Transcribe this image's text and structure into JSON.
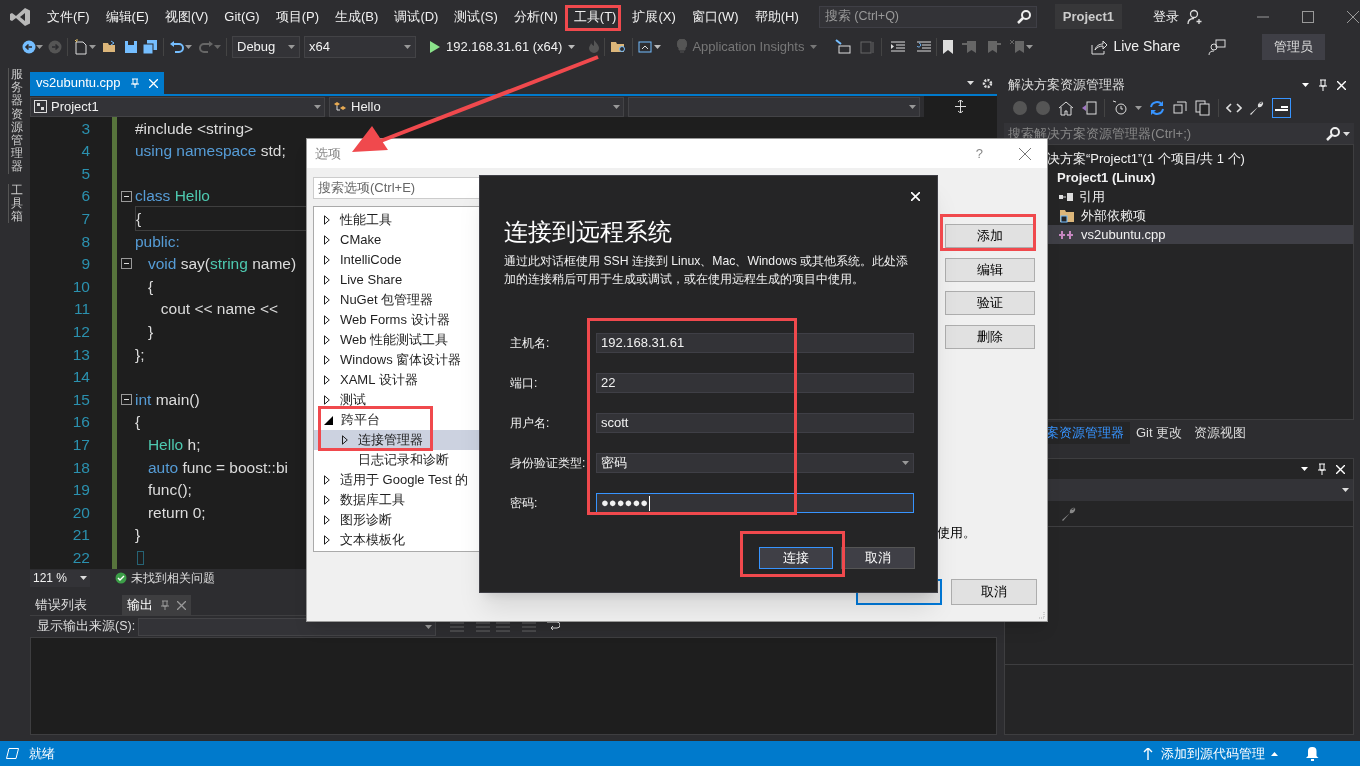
{
  "menu": [
    {
      "label": "文件(F)"
    },
    {
      "label": "编辑(E)"
    },
    {
      "label": "视图(V)"
    },
    {
      "label": "Git(G)"
    },
    {
      "label": "项目(P)"
    },
    {
      "label": "生成(B)"
    },
    {
      "label": "调试(D)"
    },
    {
      "label": "测试(S)"
    },
    {
      "label": "分析(N)"
    },
    {
      "label": "工具(T)"
    },
    {
      "label": "扩展(X)"
    },
    {
      "label": "窗口(W)"
    },
    {
      "label": "帮助(H)"
    }
  ],
  "search": {
    "placeholder": "搜索 (Ctrl+Q)"
  },
  "solution_name": "Project1",
  "sign_in": "登录",
  "toolbar": {
    "configuration": "Debug",
    "platform": "x64",
    "run_target": "192.168.31.61 (x64)",
    "insights": "Application Insights",
    "live_share": "Live Share",
    "admin": "管理员"
  },
  "side_tabs": [
    {
      "label": "服务器资源管理器"
    },
    {
      "label": "工具箱"
    }
  ],
  "editor": {
    "tabs": [
      {
        "label": "vs2ubuntu.cpp",
        "selected": true
      }
    ],
    "nav": [
      "Project1",
      "Hello"
    ],
    "lines": [
      {
        "number": "3",
        "fold": false,
        "highlight": false,
        "tokens": [
          {
            "text": "#include <string>",
            "kind": "plain"
          }
        ]
      },
      {
        "number": "4",
        "fold": false,
        "highlight": false,
        "tokens": [
          {
            "text": "using namespace",
            "kind": "kw"
          },
          {
            "text": " std;",
            "kind": "plain"
          }
        ]
      },
      {
        "number": "5",
        "fold": false,
        "highlight": false
      },
      {
        "number": "6",
        "fold": true,
        "highlight": false,
        "tokens": [
          {
            "text": "class",
            "kind": "kw"
          },
          {
            "text": " Hello",
            "kind": "type"
          }
        ]
      },
      {
        "number": "7",
        "fold": false,
        "highlight": true,
        "tokens": [
          {
            "text": "{",
            "kind": "plain"
          }
        ]
      },
      {
        "number": "8",
        "fold": false,
        "highlight": false,
        "tokens": [
          {
            "text": "public:",
            "kind": "kw"
          }
        ]
      },
      {
        "number": "9",
        "fold": true,
        "highlight": false,
        "tokens": [
          {
            "text": "   void",
            "kind": "kw"
          },
          {
            "text": " say(",
            "kind": "plain"
          },
          {
            "text": "string",
            "kind": "type"
          },
          {
            "text": " name)",
            "kind": "plain"
          }
        ]
      },
      {
        "number": "10",
        "fold": false,
        "highlight": false,
        "tokens": [
          {
            "text": "   {",
            "kind": "plain"
          }
        ]
      },
      {
        "number": "11",
        "fold": false,
        "highlight": false,
        "tokens": [
          {
            "text": "      cout << name <<",
            "kind": "plain"
          }
        ]
      },
      {
        "number": "12",
        "fold": false,
        "highlight": false,
        "tokens": [
          {
            "text": "   }",
            "kind": "plain"
          }
        ]
      },
      {
        "number": "13",
        "fold": false,
        "highlight": false,
        "tokens": [
          {
            "text": "};",
            "kind": "plain"
          }
        ]
      },
      {
        "number": "14",
        "fold": false,
        "highlight": false
      },
      {
        "number": "15",
        "fold": true,
        "highlight": false,
        "tokens": [
          {
            "text": "int",
            "kind": "kw"
          },
          {
            "text": " main()",
            "kind": "plain"
          }
        ]
      },
      {
        "number": "16",
        "fold": false,
        "highlight": false,
        "tokens": [
          {
            "text": "{",
            "kind": "plain"
          }
        ]
      },
      {
        "number": "17",
        "fold": false,
        "highlight": false,
        "tokens": [
          {
            "text": "   Hello",
            "kind": "type"
          },
          {
            "text": " h;",
            "kind": "plain"
          }
        ]
      },
      {
        "number": "18",
        "fold": false,
        "highlight": false,
        "tokens": [
          {
            "text": "   auto",
            "kind": "kw"
          },
          {
            "text": " func = boost::bi",
            "kind": "plain"
          }
        ]
      },
      {
        "number": "19",
        "fold": false,
        "highlight": false,
        "tokens": [
          {
            "text": "   func();",
            "kind": "plain"
          }
        ]
      },
      {
        "number": "20",
        "fold": false,
        "highlight": false,
        "tokens": [
          {
            "text": "   return 0;",
            "kind": "plain"
          }
        ]
      },
      {
        "number": "21",
        "fold": false,
        "highlight": false,
        "tokens": [
          {
            "text": "}",
            "kind": "plain"
          }
        ]
      },
      {
        "number": "22",
        "fold": false,
        "highlight": false
      }
    ],
    "zoom": "121 %",
    "issues": "未找到相关问题"
  },
  "output_panel": {
    "tabs": [
      {
        "label": "错误列表",
        "selected": false
      },
      {
        "label": "输出",
        "selected": true
      }
    ],
    "source_label": "显示输出来源(S):"
  },
  "solution_explorer": {
    "title": "解决方案资源管理器",
    "search_placeholder": "搜索解决方案资源管理器(Ctrl+;)",
    "tree": [
      {
        "label": "决方案“Project1”(1 个项目/共 1 个)",
        "selected": false,
        "children": [
          {
            "label": "Project1 (Linux)",
            "kind": "project",
            "selected": false,
            "children": [
              {
                "label": "引用",
                "kind": "references",
                "selected": false
              },
              {
                "label": "外部依赖项",
                "kind": "external",
                "selected": false
              },
              {
                "label": "vs2ubuntu.cpp",
                "kind": "cpp",
                "selected": true
              }
            ]
          }
        ]
      }
    ],
    "tabs": [
      {
        "label": "案资源管理器",
        "selected": true
      },
      {
        "label": "Git 更改",
        "selected": false
      },
      {
        "label": "资源视图",
        "selected": false
      }
    ]
  },
  "options_dialog": {
    "title": "选项",
    "help": "?",
    "search_placeholder": "搜索选项(Ctrl+E)",
    "tree": [
      {
        "label": "性能工具",
        "expandable": true,
        "expanded": false,
        "selected": false
      },
      {
        "label": "CMake",
        "expandable": true,
        "expanded": false,
        "selected": false
      },
      {
        "label": "IntelliCode",
        "expandable": true,
        "expanded": false,
        "selected": false
      },
      {
        "label": "Live Share",
        "expandable": true,
        "expanded": false,
        "selected": false
      },
      {
        "label": "NuGet 包管理器",
        "expandable": true,
        "expanded": false,
        "selected": false
      },
      {
        "label": "Web Forms 设计器",
        "expandable": true,
        "expanded": false,
        "selected": false
      },
      {
        "label": "Web 性能测试工具",
        "expandable": true,
        "expanded": false,
        "selected": false
      },
      {
        "label": "Windows 窗体设计器",
        "expandable": true,
        "expanded": false,
        "selected": false
      },
      {
        "label": "XAML 设计器",
        "expandable": true,
        "expanded": false,
        "selected": false
      },
      {
        "label": "测试",
        "expandable": true,
        "expanded": false,
        "selected": false
      },
      {
        "label": "跨平台",
        "expandable": true,
        "expanded": true,
        "selected": false,
        "children": [
          {
            "label": "连接管理器",
            "expandable": true,
            "expanded": false,
            "selected": true
          },
          {
            "label": "日志记录和诊断",
            "expandable": false,
            "selected": false
          }
        ]
      },
      {
        "label": "适用于 Google Test 的",
        "expandable": true,
        "expanded": false,
        "selected": false
      },
      {
        "label": "数据库工具",
        "expandable": true,
        "expanded": false,
        "selected": false
      },
      {
        "label": "图形诊断",
        "expandable": true,
        "expanded": false,
        "selected": false
      },
      {
        "label": "文本模板化",
        "expandable": true,
        "expanded": false,
        "selected": false
      }
    ],
    "buttons": [
      "添加",
      "编辑",
      "验证",
      "删除"
    ],
    "note": "使用。",
    "cancel": "取消"
  },
  "connect_dialog": {
    "heading": "连接到远程系统",
    "description": "通过此对话框使用 SSH 连接到 Linux、Mac、Windows 或其他系统。此处添加的连接稍后可用于生成或调试，或在使用远程生成的项目中使用。",
    "fields": [
      {
        "label": "主机名:",
        "value": "192.168.31.61",
        "kind": "text",
        "focused": false
      },
      {
        "label": "端口:",
        "value": "22",
        "kind": "text",
        "focused": false
      },
      {
        "label": "用户名:",
        "value": "scott",
        "kind": "text",
        "focused": false
      },
      {
        "label": "身份验证类型:",
        "value": "密码",
        "kind": "select",
        "focused": false
      },
      {
        "label": "密码:",
        "value": "●●●●●●",
        "kind": "password",
        "focused": true
      }
    ],
    "buttons": [
      {
        "label": "连接",
        "default": true
      },
      {
        "label": "取消",
        "default": false
      }
    ]
  },
  "status_bar": {
    "text": "就绪",
    "source_control": "添加到源代码管理"
  }
}
